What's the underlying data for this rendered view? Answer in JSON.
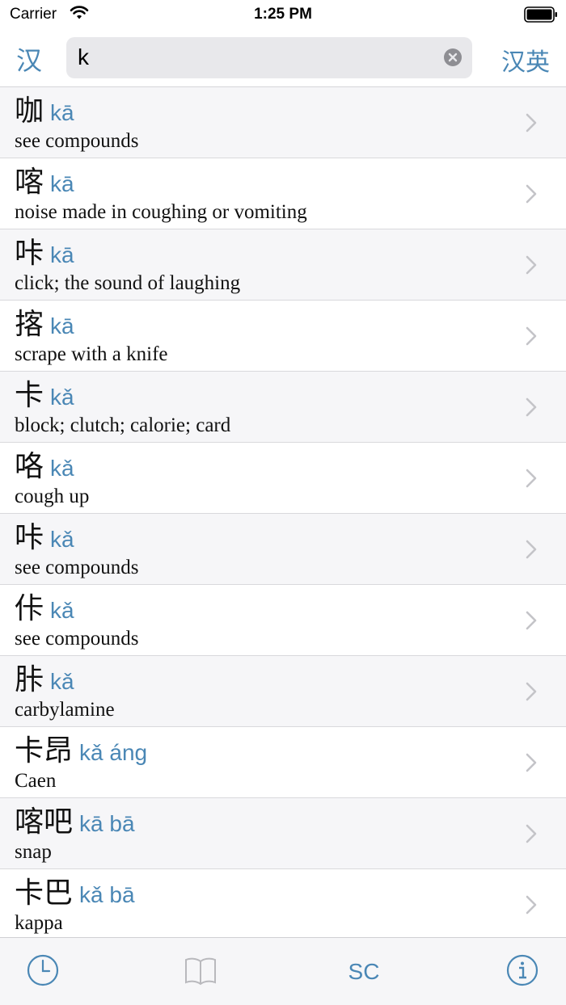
{
  "status_bar": {
    "carrier": "Carrier",
    "time": "1:25 PM"
  },
  "search": {
    "lang_left": "汉",
    "query": "k",
    "lang_right": "汉英"
  },
  "colors": {
    "accent": "#4a87b5",
    "row_alt": "#f6f6f8"
  },
  "results": [
    {
      "hanzi": "咖",
      "pinyin": "kā",
      "gloss": "see compounds"
    },
    {
      "hanzi": "喀",
      "pinyin": "kā",
      "gloss": "noise made in coughing or vomiting"
    },
    {
      "hanzi": "咔",
      "pinyin": "kā",
      "gloss": "click; the sound of laughing"
    },
    {
      "hanzi": "揢",
      "pinyin": "kā",
      "gloss": "scrape with a knife"
    },
    {
      "hanzi": "卡",
      "pinyin": "kǎ",
      "gloss": "block; clutch; calorie; card"
    },
    {
      "hanzi": "咯",
      "pinyin": "kǎ",
      "gloss": "cough up"
    },
    {
      "hanzi": "咔",
      "pinyin": "kǎ",
      "gloss": "see compounds"
    },
    {
      "hanzi": "佧",
      "pinyin": "kǎ",
      "gloss": "see compounds"
    },
    {
      "hanzi": "胩",
      "pinyin": "kǎ",
      "gloss": "carbylamine"
    },
    {
      "hanzi": "卡昂",
      "pinyin": "kǎ áng",
      "gloss": "Caen"
    },
    {
      "hanzi": "喀吧",
      "pinyin": "kā bā",
      "gloss": "snap"
    },
    {
      "hanzi": "卡巴",
      "pinyin": "kǎ bā",
      "gloss": "kappa"
    }
  ],
  "tab_bar": {
    "tabs": [
      {
        "icon": "clock-icon"
      },
      {
        "icon": "book-icon"
      },
      {
        "label": "SC"
      },
      {
        "icon": "info-icon"
      }
    ]
  }
}
